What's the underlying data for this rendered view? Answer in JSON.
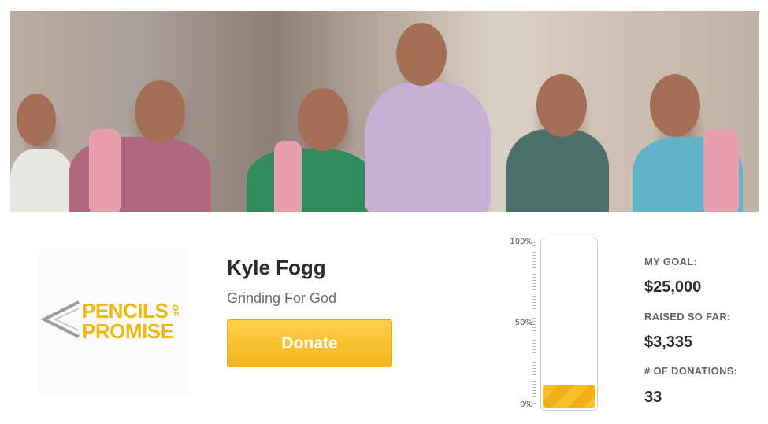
{
  "hero": {
    "image": "children-running-photo"
  },
  "charity": {
    "logo_line1": "PENCILS",
    "logo_of": "OF",
    "logo_line2": "PROMISE",
    "brand_color": "#f2b715"
  },
  "fundraiser": {
    "name": "Kyle Fogg",
    "tagline": "Grinding For God",
    "donate_label": "Donate"
  },
  "progress": {
    "scale_top": "100%",
    "scale_mid": "50%",
    "scale_bottom": "0%",
    "raised_fraction": 0.1334,
    "fill_color": "#f5b51c"
  },
  "stats": {
    "goal_label": "MY GOAL:",
    "goal_value": "$25,000",
    "raised_label": "RAISED SO FAR:",
    "raised_value": "$3,335",
    "donations_label": "# OF DONATIONS:",
    "donations_value": "33"
  }
}
